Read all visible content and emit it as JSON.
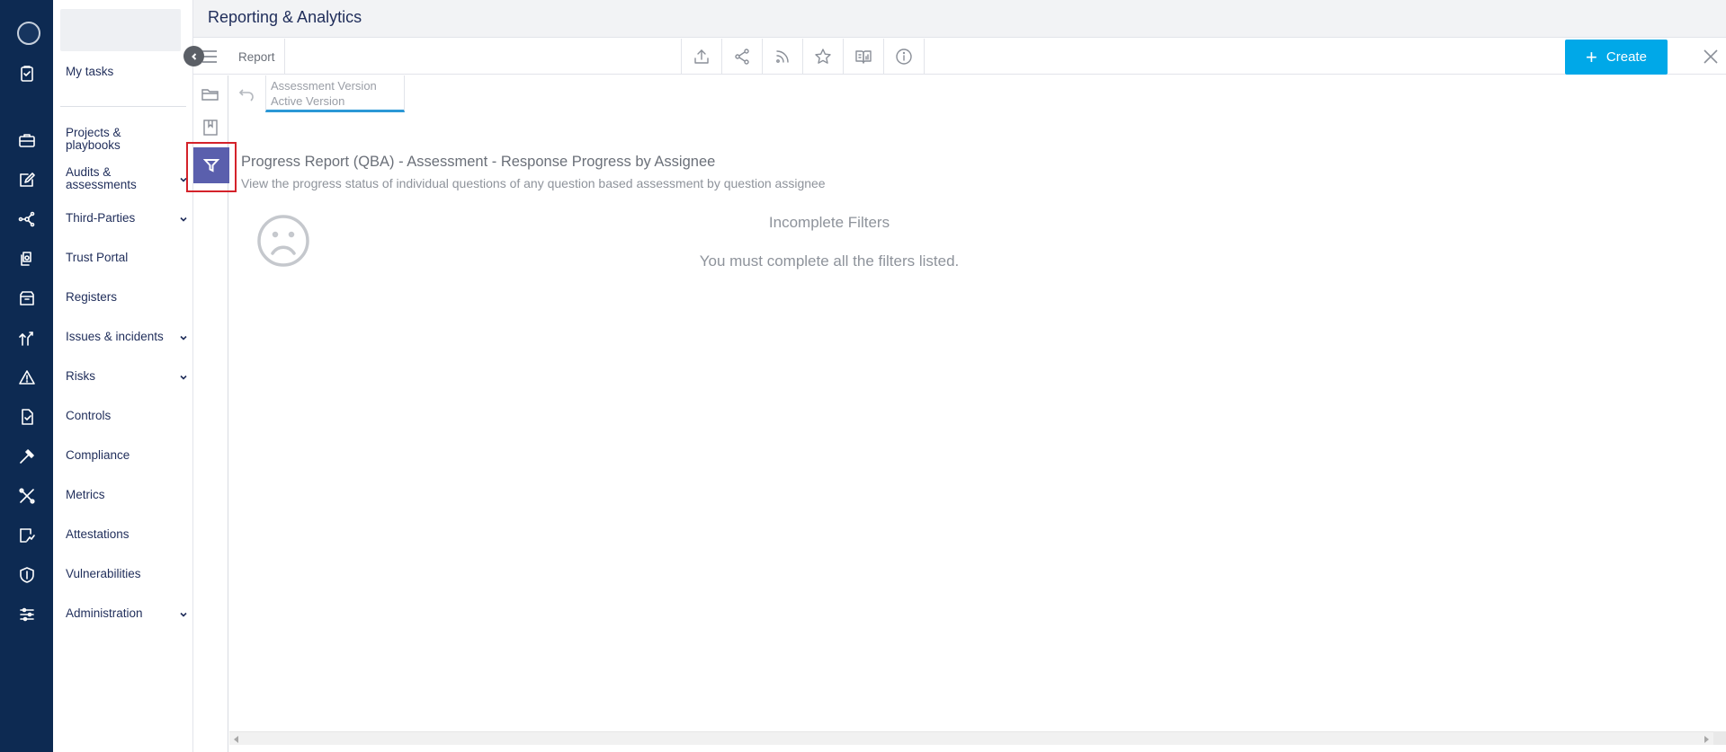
{
  "header": {
    "title": "Reporting & Analytics"
  },
  "rail": {
    "icons": [
      "avatar",
      "tasks-icon",
      "briefcase-icon",
      "edit-icon",
      "network-icon",
      "documents-icon",
      "archive-icon",
      "growth-icon",
      "warning-icon",
      "checklist-icon",
      "gavel-icon",
      "tools-icon",
      "chart-doc-icon",
      "shield-icon",
      "sliders-icon"
    ]
  },
  "nav": {
    "items": [
      {
        "label": "My tasks",
        "has_chevron": false
      },
      {
        "label": "Projects &\nplaybooks",
        "has_chevron": false
      },
      {
        "label": "Audits &\nassessments",
        "has_chevron": true
      },
      {
        "label": "Third-Parties",
        "has_chevron": true
      },
      {
        "label": "Trust Portal",
        "has_chevron": false
      },
      {
        "label": "Registers",
        "has_chevron": false
      },
      {
        "label": "Issues & incidents",
        "has_chevron": true
      },
      {
        "label": "Risks",
        "has_chevron": true
      },
      {
        "label": "Controls",
        "has_chevron": false
      },
      {
        "label": "Compliance",
        "has_chevron": false
      },
      {
        "label": "Metrics",
        "has_chevron": false
      },
      {
        "label": "Attestations",
        "has_chevron": false
      },
      {
        "label": "Vulnerabilities",
        "has_chevron": false
      },
      {
        "label": "Administration",
        "has_chevron": true
      }
    ]
  },
  "toolbar": {
    "report_label": "Report",
    "icons": [
      "upload-icon",
      "share-icon",
      "rss-icon",
      "star-icon",
      "book-chart-icon",
      "info-icon"
    ],
    "create_label": "Create"
  },
  "version_tab": {
    "line1": "Assessment Version",
    "line2": "Active Version"
  },
  "report": {
    "title": "Progress Report (QBA) - Assessment - Response Progress by Assignee",
    "description": "View the progress status of individual questions of any question based assessment by question assignee"
  },
  "empty_state": {
    "title": "Incomplete Filters",
    "message": "You must complete all the filters listed."
  },
  "colors": {
    "rail": "#0d2a52",
    "accent": "#00a8e8",
    "filter_active": "#5a5fad",
    "highlight": "#d4222a"
  }
}
